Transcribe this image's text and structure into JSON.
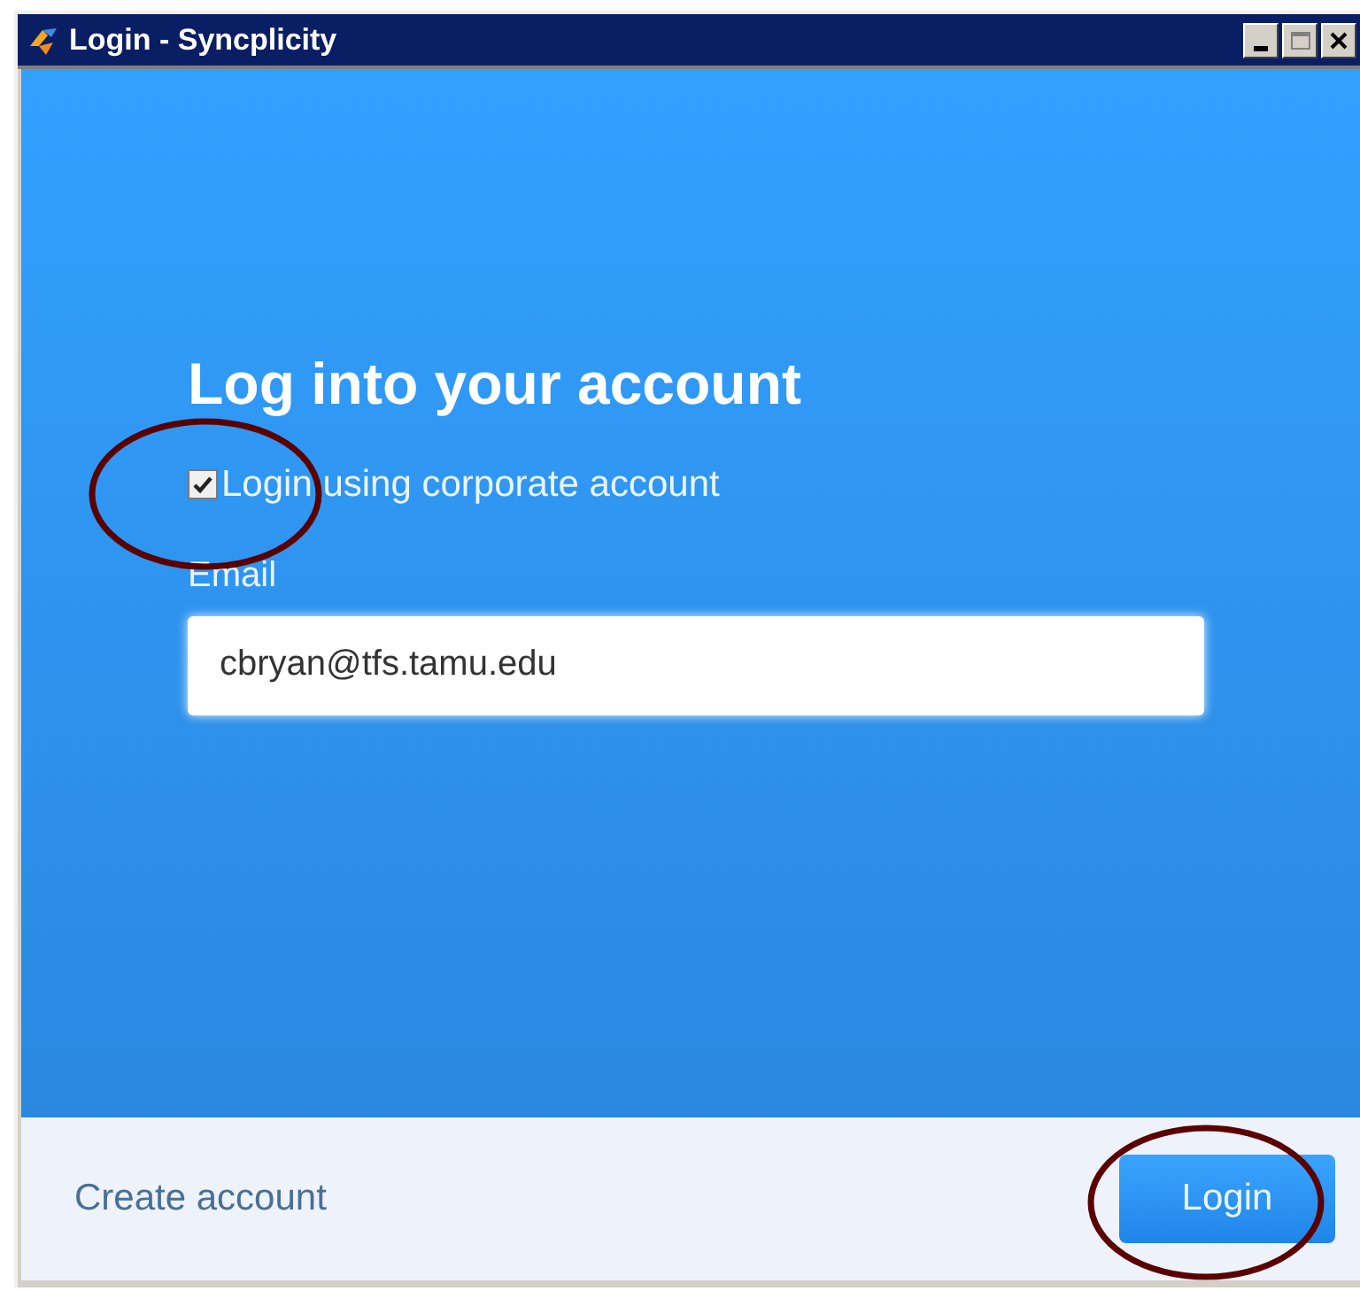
{
  "window": {
    "title": "Login - Syncplicity"
  },
  "heading": "Log into your account",
  "corporate_checkbox": {
    "label": "Login using corporate account",
    "checked": true
  },
  "email": {
    "label": "Email",
    "value": "cbryan@tfs.tamu.edu"
  },
  "footer": {
    "link": "Create account",
    "button": "Login"
  }
}
